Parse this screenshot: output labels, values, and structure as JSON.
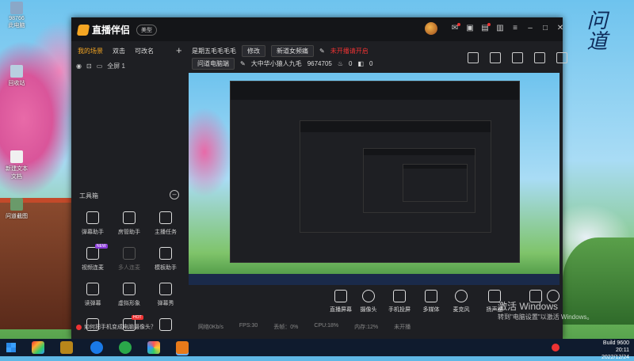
{
  "desktop": {
    "icons": [
      {
        "label": "98766"
      },
      {
        "label": "此电脑"
      },
      {
        "label": "回收站"
      },
      {
        "label": "新建文本文档"
      },
      {
        "label": "问道截图"
      }
    ]
  },
  "app": {
    "name": "直播伴侣",
    "version_badge": "美型",
    "left_tabs": [
      "我的场景",
      "双击",
      "可改名"
    ],
    "scene_name": "全屏 1",
    "tools_title": "工具箱",
    "tools": [
      {
        "label": "弹幕助手",
        "icon": "danmu-icon"
      },
      {
        "label": "房管助手",
        "icon": "admin-icon"
      },
      {
        "label": "主播任务",
        "icon": "task-icon"
      },
      {
        "label": "视频连麦",
        "icon": "video-call-icon",
        "tag": "NEW"
      },
      {
        "label": "多人连麦",
        "icon": "multi-call-icon",
        "dim": true
      },
      {
        "label": "模板助手",
        "icon": "template-icon"
      },
      {
        "label": "读弹幕",
        "icon": "read-danmu-icon"
      },
      {
        "label": "虚拟形象",
        "icon": "avatar-icon"
      },
      {
        "label": "弹幕秀",
        "icon": "danmu-show-icon"
      },
      {
        "label": "",
        "icon": "more-icon"
      },
      {
        "label": "",
        "icon": "hot-icon",
        "tag": "HOT"
      },
      {
        "label": "",
        "icon": "download-icon"
      }
    ],
    "tip": "如何把手机变成电脑摄像头？",
    "stream": {
      "title": "是期五毛毛毛毛",
      "edit": "修改",
      "category": "新道女频痛",
      "alert": "未开播请开启",
      "source": "问道电脑端",
      "meta": "大中华小猿人九毛",
      "fans": "9674705",
      "likes": "0",
      "viewers": "0"
    },
    "controls": [
      {
        "label": "直播屏幕",
        "icon": "screen-icon"
      },
      {
        "label": "摄像头",
        "icon": "camera-icon"
      },
      {
        "label": "手机投屏",
        "icon": "phone-cast-icon"
      },
      {
        "label": "多媒体",
        "icon": "media-icon"
      },
      {
        "label": "麦克风",
        "icon": "mic-icon"
      },
      {
        "label": "扬声器",
        "icon": "speaker-icon"
      }
    ],
    "status": {
      "net": "网络0Kb/s",
      "fps": "FPS:30",
      "drop": "丢帧：0%",
      "cpu": "CPU:18%",
      "mem": "内存:12%",
      "end": "未开播"
    }
  },
  "windows": {
    "activate_title": "激活 Windows",
    "activate_sub": "转到\"电脑设置\"以激活 Windows。",
    "build": "Build 9600",
    "time": "20:11",
    "date": "2022/12/24"
  },
  "colors": {
    "accent": "#f5a623",
    "alert": "#e33333",
    "window_bg": "#1e1f23"
  }
}
